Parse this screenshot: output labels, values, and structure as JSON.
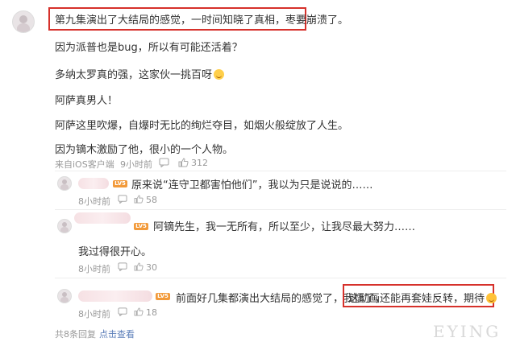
{
  "main_comment": {
    "lines": [
      "第九集演出了大结局的感觉，一时间知晓了真相，枣要崩溃了。",
      "因为派普也是bug，所以有可能还活着？",
      "多纳太罗真的强，这家伙一挑百呀",
      "阿萨真男人！",
      "阿萨这里吹爆，自爆时无比的绚烂夺目，如烟火般绽放了人生。",
      "因为镝木激励了他，很小的一个人物。"
    ],
    "source": "来自iOS客户端",
    "time": "9小时前",
    "like_count": "312"
  },
  "replies": [
    {
      "text": "原来说“连守卫都害怕他们”，我以为只是说说的……",
      "time": "8小时前",
      "like_count": "58",
      "badge": "LV5"
    },
    {
      "text": "阿镝先生，我一无所有，所以至少，让我尽最大努力……",
      "text2": "我过得很开心。",
      "time": "8小时前",
      "like_count": "30",
      "badge": "LV5"
    },
    {
      "text": "前面好几集都演出大结局的感觉了，我悟了，",
      "text_highlight": "这动画还能再套娃反转，期待",
      "time": "8小时前",
      "like_count": "18",
      "badge": "LV5"
    }
  ],
  "footer": {
    "count": "共8条回复",
    "expand_link": "点击查看"
  },
  "watermark": "EYING",
  "colors": {
    "highlight_border": "#d6312b",
    "badge": "#f29a3a",
    "link": "#5a7db8"
  }
}
